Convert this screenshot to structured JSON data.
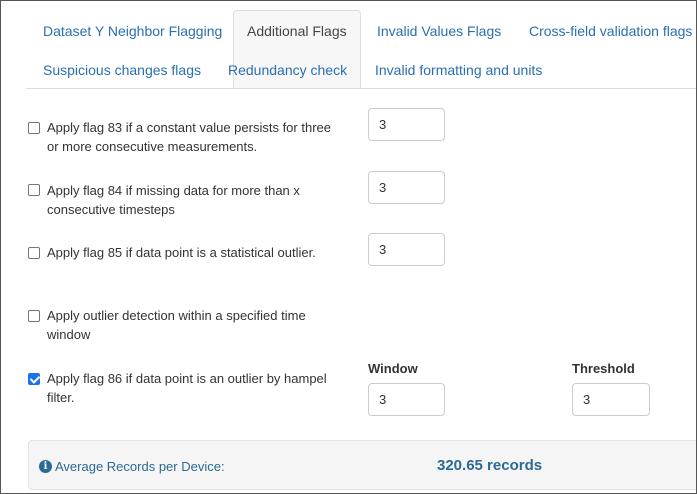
{
  "tabs": [
    {
      "label": "Dataset Y Neighbor Flagging"
    },
    {
      "label": "Additional Flags"
    },
    {
      "label": "Invalid Values Flags"
    },
    {
      "label": "Cross-field validation flags"
    },
    {
      "label": "Suspicious changes flags"
    },
    {
      "label": "Redundancy check"
    },
    {
      "label": "Invalid formatting and units"
    }
  ],
  "active_tab": "Additional Flags",
  "flags": [
    {
      "label": "Apply flag 83 if a constant value persists for three or more consecutive measurements.",
      "checked": false,
      "value": "3"
    },
    {
      "label": "Apply flag 84 if missing data for more than x consecutive timesteps",
      "checked": false,
      "value": "3"
    },
    {
      "label": "Apply flag 85 if data point is a statistical outlier.",
      "checked": false,
      "value": "3"
    },
    {
      "label": "Apply outlier detection within a specified time window",
      "checked": false
    },
    {
      "label": "Apply flag 86 if data point is an outlier by hampel filter.",
      "checked": true
    }
  ],
  "hampel": {
    "window_label": "Window",
    "window_value": "3",
    "threshold_label": "Threshold",
    "threshold_value": "3"
  },
  "summary": {
    "icon": "info-icon",
    "label": "Average Records per Device:",
    "value": "320.65 records"
  },
  "colors": {
    "link": "#2a6fb0",
    "summary_text": "#2a6a94",
    "checkbox_checked": "#1a73e8"
  }
}
